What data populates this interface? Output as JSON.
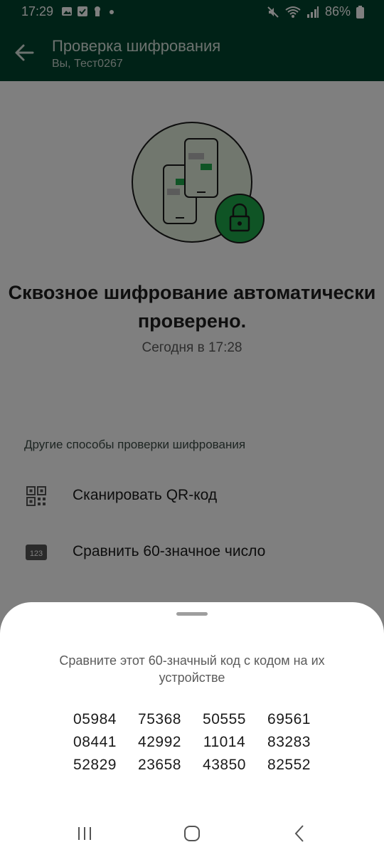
{
  "status_bar": {
    "time": "17:29",
    "battery": "86%",
    "left_icons": [
      "image-icon",
      "check-box-icon",
      "keyhole-icon",
      "dot-icon"
    ],
    "right_icons": [
      "mute-icon",
      "wifi-icon",
      "signal-icon",
      "battery-icon"
    ]
  },
  "app_bar": {
    "title": "Проверка шифрования",
    "subtitle": "Вы, Тест0267",
    "back_icon": "arrow-back-icon"
  },
  "main": {
    "headline": "Сквозное шифрование автоматически проверено.",
    "date": "Сегодня в 17:28",
    "section_title": "Другие способы проверки шифрования",
    "options": [
      {
        "icon": "qr-code-icon",
        "label": "Сканировать QR-код"
      },
      {
        "icon": "number-123-icon",
        "label": "Сравнить 60-значное число"
      }
    ]
  },
  "sheet": {
    "instruction": "Сравните этот 60-значный код с кодом на их устройстве",
    "codes": [
      "05984",
      "75368",
      "50555",
      "69561",
      "08441",
      "42992",
      "11014",
      "83283",
      "52829",
      "23658",
      "43850",
      "82552"
    ]
  },
  "nav_bar": {
    "icons": [
      "recent-apps-icon",
      "home-icon",
      "back-icon"
    ]
  },
  "colors": {
    "header": "#00452e",
    "accent_green": "#1fa94b",
    "illustration_bg": "#e3efdc"
  }
}
